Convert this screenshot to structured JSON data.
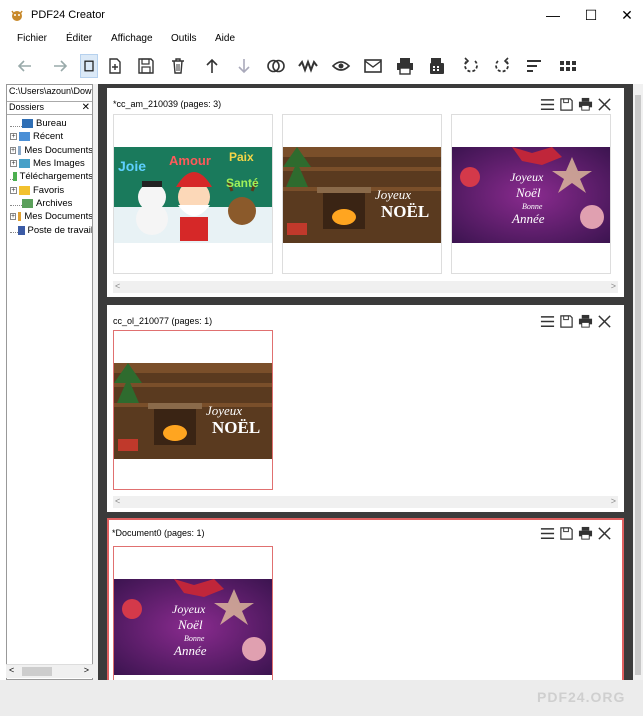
{
  "app": {
    "title": "PDF24 Creator"
  },
  "window_controls": {
    "minimize": "—",
    "maximize": "☐",
    "close": "✕"
  },
  "menu": [
    "Fichier",
    "Éditer",
    "Affichage",
    "Outils",
    "Aide"
  ],
  "toolbar": {
    "buttons": [
      "back-icon",
      "forward-icon",
      "new-document-icon",
      "save-icon",
      "delete-icon",
      "move-up-icon",
      "move-down-icon",
      "merge-icon",
      "split-icon",
      "view-icon",
      "email-icon",
      "print-icon",
      "fax-icon",
      "rotate-left-icon",
      "rotate-right-icon",
      "sort-icon",
      "grid-icon"
    ]
  },
  "left_panel": {
    "path": "C:\\Users\\azoun\\Downloads",
    "header": "Dossiers",
    "close": "✕",
    "tree": [
      {
        "label": "Bureau",
        "expander": "",
        "icon_color": "#2f6fb5"
      },
      {
        "label": "Récent",
        "expander": "+",
        "icon_color": "#4a8fd6"
      },
      {
        "label": "Mes Documents",
        "expander": "+",
        "icon_color": "#8aa9c9"
      },
      {
        "label": "Mes Images",
        "expander": "+",
        "icon_color": "#46a0c8"
      },
      {
        "label": "Téléchargements",
        "expander": "",
        "icon_color": "#4caf50"
      },
      {
        "label": "Favoris",
        "expander": "+",
        "icon_color": "#f2c12e"
      },
      {
        "label": "Archives",
        "expander": "",
        "icon_color": "#5ba05b"
      },
      {
        "label": "Mes Documents",
        "expander": "+",
        "icon_color": "#e0a030"
      },
      {
        "label": "Poste de travail",
        "expander": "",
        "icon_color": "#3b5ba5"
      }
    ]
  },
  "documents": [
    {
      "title": "*cc_am_210039 (pages: 3)"
    },
    {
      "title": "cc_ol_210077 (pages: 1)"
    },
    {
      "title": "*Document0 (pages: 1)"
    }
  ],
  "scroll_arrows": {
    "left": "<",
    "right": ">"
  },
  "thumbnails": {
    "joie_words": [
      "Joie",
      "Amour",
      "Paix",
      "Santé"
    ],
    "noel_words": [
      "Joyeux",
      "NOËL"
    ],
    "annee_words": [
      "Joyeux",
      "Noël",
      "Bonne",
      "Année"
    ]
  },
  "watermark": "PDF24.ORG",
  "colors": {
    "selection_border": "#e06060",
    "main_bg": "#3b3b3b"
  }
}
